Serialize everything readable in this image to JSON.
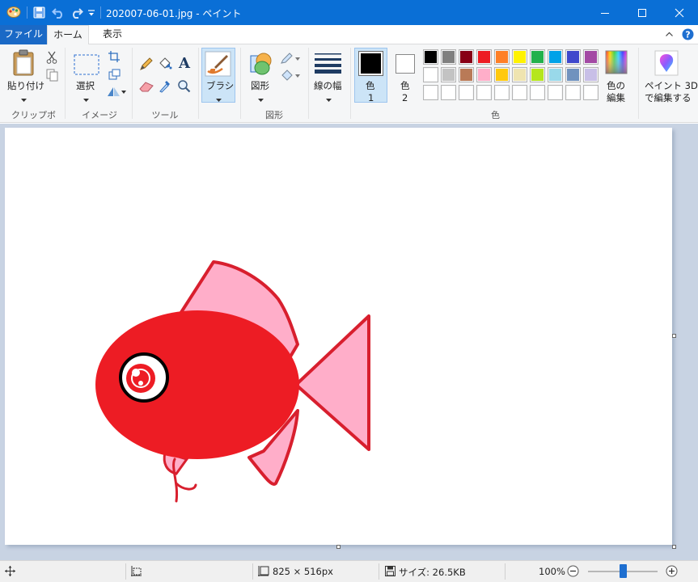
{
  "window": {
    "title": "202007-06-01.jpg - ペイント"
  },
  "tabs": [
    {
      "label": "ファイル"
    },
    {
      "label": "ホーム"
    },
    {
      "label": "表示"
    }
  ],
  "ribbon": {
    "clipboard": {
      "paste_label": "貼り付け",
      "group_label": "クリップボード"
    },
    "image": {
      "select_label": "選択",
      "group_label": "イメージ"
    },
    "tools": {
      "group_label": "ツール"
    },
    "brush": {
      "label": "ブラシ"
    },
    "shapes": {
      "shape_label": "図形",
      "group_label": "図形"
    },
    "size": {
      "label": "線の幅"
    },
    "colors": {
      "color1_label": "色",
      "color1_num": "1",
      "color2_label": "色",
      "color2_num": "2",
      "edit_label_1": "色の",
      "edit_label_2": "編集",
      "group_label": "色",
      "color1_value": "#000000",
      "color2_value": "#ffffff",
      "palette_row1": [
        "#000000",
        "#7f7f7f",
        "#880015",
        "#ed1c24",
        "#ff7f27",
        "#fff200",
        "#22b14c",
        "#00a2e8",
        "#3f48cc",
        "#a349a4"
      ],
      "palette_row2": [
        "#ffffff",
        "#c3c3c3",
        "#b97a57",
        "#ffaec9",
        "#ffc90e",
        "#efe4b0",
        "#b5e61d",
        "#99d9ea",
        "#7092be",
        "#c8bfe7"
      ],
      "palette_row3": [
        "#ffffff",
        "#ffffff",
        "#ffffff",
        "#ffffff",
        "#ffffff",
        "#ffffff",
        "#ffffff",
        "#ffffff",
        "#ffffff",
        "#ffffff"
      ]
    },
    "paint3d": {
      "label_1": "ペイント 3D",
      "label_2": "で編集する"
    }
  },
  "drawing": {
    "body_color": "#ed1c24",
    "fin_color": "#ffaec9",
    "outline_color": "#d81f2e"
  },
  "status": {
    "image_size": "825 × 516px",
    "file_size": "サイズ: 26.5KB",
    "zoom": "100%",
    "zoom_fraction": 0.5
  }
}
